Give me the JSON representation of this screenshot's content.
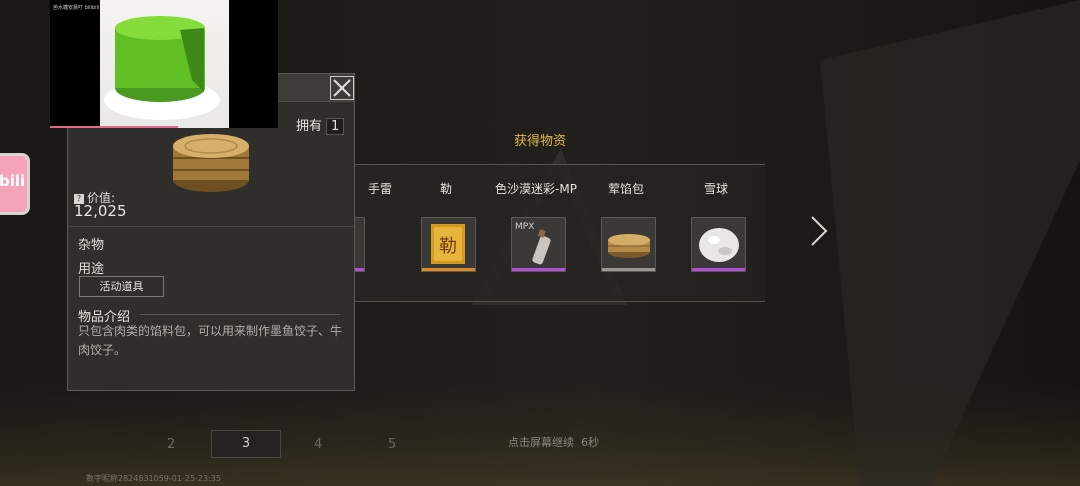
{
  "title": "获得物资",
  "rewards": [
    {
      "name": "手雷",
      "rarity_color": "#b04fd6",
      "icon": "grenade-icon"
    },
    {
      "name": "勒",
      "rarity_color": "#e08a2a",
      "icon": "golden-card-icon",
      "icon_text": "勒"
    },
    {
      "name": "色沙漠迷彩-MP",
      "rarity_color": "#b04fd6",
      "icon": "spray-can-icon",
      "icon_text": "MPX"
    },
    {
      "name": "荤馅包",
      "rarity_color": "#9a9890",
      "icon": "steamer-basket-icon"
    },
    {
      "name": "雪球",
      "rarity_color": "#b04fd6",
      "icon": "snowball-icon"
    }
  ],
  "detail": {
    "owned_label": "拥有",
    "owned_count": "1",
    "value_label": "价值:",
    "value": "12,025",
    "category": "杂物",
    "usage_title": "用途",
    "usage_tag": "活动道具",
    "desc_title": "物品介绍",
    "description": "只包含肉类的馅料包，可以用来制作墨鱼饺子、牛肉饺子。"
  },
  "video": {
    "caption": "芭水糖安晨叮 bilibili",
    "progress": 0.56
  },
  "side_app": {
    "label": "bili"
  },
  "pages": [
    "2",
    "3",
    "4",
    "5"
  ],
  "active_page": "3",
  "continue_text": "点击屏幕继续",
  "countdown": "6秒",
  "watermark": "数字昵称2824831059-01-25-23:35"
}
